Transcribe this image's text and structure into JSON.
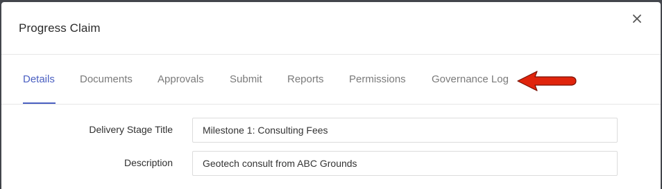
{
  "modal": {
    "title": "Progress Claim",
    "close_label": "×"
  },
  "tabs": [
    {
      "label": "Details",
      "active": true
    },
    {
      "label": "Documents",
      "active": false
    },
    {
      "label": "Approvals",
      "active": false
    },
    {
      "label": "Submit",
      "active": false
    },
    {
      "label": "Reports",
      "active": false
    },
    {
      "label": "Permissions",
      "active": false
    },
    {
      "label": "Governance Log",
      "active": false
    }
  ],
  "annotation": {
    "icon": "red-arrow-left-icon",
    "color": "#e0240c"
  },
  "form": {
    "delivery_stage_title": {
      "label": "Delivery Stage Title",
      "value": "Milestone 1: Consulting Fees"
    },
    "description": {
      "label": "Description",
      "value": "Geotech consult from ABC Grounds"
    }
  },
  "colors": {
    "accent": "#4a5fc1",
    "backdrop": "#43464c"
  }
}
